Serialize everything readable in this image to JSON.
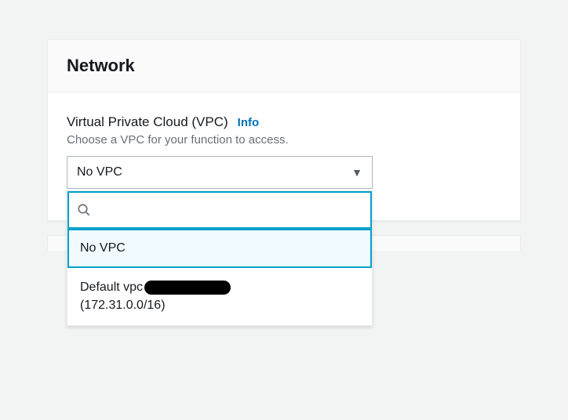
{
  "panel": {
    "title": "Network"
  },
  "vpc_field": {
    "label": "Virtual Private Cloud (VPC)",
    "info_link": "Info",
    "hint": "Choose a VPC for your function to access.",
    "selected": "No VPC",
    "search_value": "",
    "options": [
      {
        "label": "No VPC",
        "selected": true
      },
      {
        "label_prefix": "Default vpc",
        "cidr": "(172.31.0.0/16)",
        "selected": false,
        "redacted": true
      }
    ]
  }
}
